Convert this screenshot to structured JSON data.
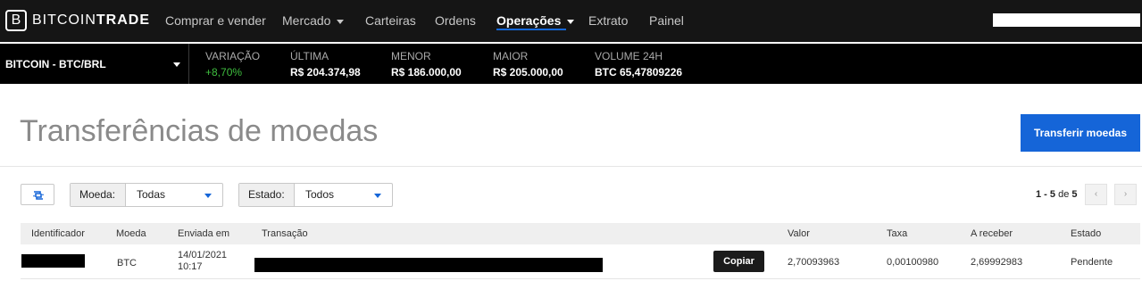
{
  "brand": {
    "logo_letter": "B",
    "name_light": "BITCOIN",
    "name_bold": "TRADE"
  },
  "nav": {
    "items": [
      {
        "label": "Comprar e vender"
      },
      {
        "label": "Mercado"
      },
      {
        "label": "Carteiras"
      },
      {
        "label": "Ordens"
      },
      {
        "label": "Operações"
      },
      {
        "label": "Extrato"
      },
      {
        "label": "Painel"
      }
    ],
    "active": "Operações"
  },
  "ticker": {
    "pair": "BITCOIN - BTC/BRL",
    "stats": [
      {
        "label": "VARIAÇÃO",
        "value": "+8,70%"
      },
      {
        "label": "ÚLTIMA",
        "value": "R$ 204.374,98"
      },
      {
        "label": "MENOR",
        "value": "R$ 186.000,00"
      },
      {
        "label": "MAIOR",
        "value": "R$ 205.000,00"
      },
      {
        "label": "VOLUME 24H",
        "value": "BTC 65,47809226"
      }
    ]
  },
  "page": {
    "title": "Transferências de moedas",
    "primary_button": "Transferir moedas"
  },
  "filters": {
    "moeda": {
      "label": "Moeda:",
      "value": "Todas"
    },
    "estado": {
      "label": "Estado:",
      "value": "Todos"
    }
  },
  "pagination": {
    "range": "1 - 5",
    "of_label": "de",
    "total": "5",
    "prev": "‹",
    "next": "›"
  },
  "table": {
    "columns": [
      "Identificador",
      "Moeda",
      "Enviada em",
      "Transação",
      "Valor",
      "Taxa",
      "A receber",
      "Estado"
    ],
    "rows": [
      {
        "moeda": "BTC",
        "date": "14/01/2021",
        "time": "10:17",
        "copy": "Copiar",
        "valor": "2,70093963",
        "taxa": "0,00100980",
        "receber": "2,69992983",
        "estado": "Pendente"
      }
    ]
  },
  "colors": {
    "nav_bg": "#151515",
    "ticker_bg": "#000000",
    "accent": "#1565d8",
    "positive": "#3fbf3f"
  },
  "icons": [
    "refresh-icon",
    "chevron-down-icon",
    "chevron-left-icon",
    "chevron-right-icon"
  ]
}
